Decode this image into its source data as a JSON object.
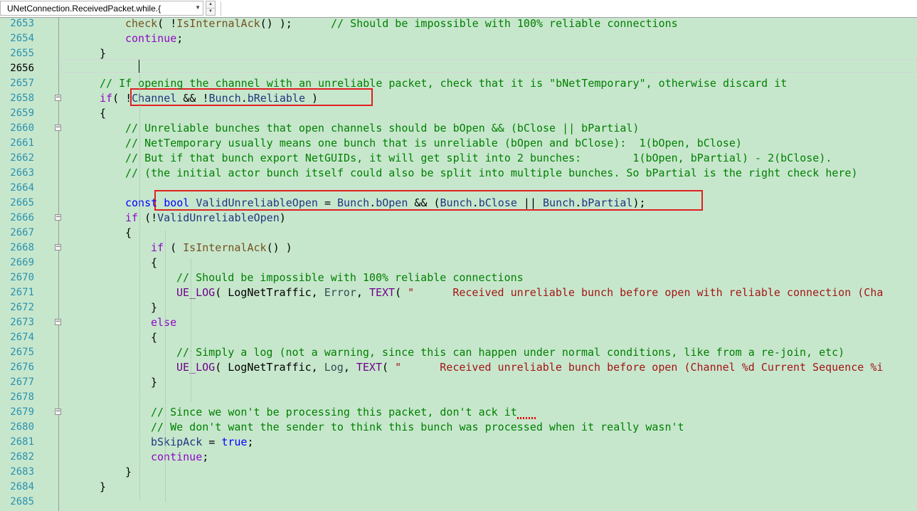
{
  "navigation": {
    "scope": "UNetConnection.ReceivedPacket.while.{"
  },
  "editor": {
    "current_line": 2656,
    "lines": [
      {
        "num": "2653",
        "indent": 4,
        "fold": false,
        "tokens": [
          [
            "fn",
            "check"
          ],
          [
            "pl",
            "( !"
          ],
          [
            "fn",
            "IsInternalAck"
          ],
          [
            "pl",
            "() );      "
          ],
          [
            "cm",
            "// Should be impossible with 100% reliable connections"
          ]
        ]
      },
      {
        "num": "2654",
        "indent": 4,
        "fold": false,
        "tokens": [
          [
            "ctl",
            "continue"
          ],
          [
            "pl",
            ";"
          ]
        ]
      },
      {
        "num": "2655",
        "indent": 3,
        "fold": false,
        "tokens": [
          [
            "pl",
            "}"
          ]
        ]
      },
      {
        "num": "2656",
        "indent": 3,
        "fold": false,
        "tokens": []
      },
      {
        "num": "2657",
        "indent": 3,
        "fold": false,
        "tokens": [
          [
            "cm",
            "// If opening the channel with an unreliable packet, check that it is \"bNetTemporary\", otherwise discard it"
          ]
        ]
      },
      {
        "num": "2658",
        "indent": 3,
        "fold": true,
        "tokens": [
          [
            "ctl",
            "if"
          ],
          [
            "pl",
            "( !"
          ],
          [
            "var",
            "Channel"
          ],
          [
            "pl",
            " && !"
          ],
          [
            "var",
            "Bunch"
          ],
          [
            "pl",
            "."
          ],
          [
            "var",
            "bReliable"
          ],
          [
            "pl",
            " )"
          ]
        ]
      },
      {
        "num": "2659",
        "indent": 3,
        "fold": false,
        "tokens": [
          [
            "pl",
            "{"
          ]
        ]
      },
      {
        "num": "2660",
        "indent": 4,
        "fold": true,
        "tokens": [
          [
            "cm",
            "// Unreliable bunches that open channels should be bOpen && (bClose || bPartial)"
          ]
        ]
      },
      {
        "num": "2661",
        "indent": 4,
        "fold": false,
        "tokens": [
          [
            "cm",
            "// NetTemporary usually means one bunch that is unreliable (bOpen and bClose):  1(bOpen, bClose)"
          ]
        ]
      },
      {
        "num": "2662",
        "indent": 4,
        "fold": false,
        "tokens": [
          [
            "cm",
            "// But if that bunch export NetGUIDs, it will get split into 2 bunches:        1(bOpen, bPartial) - 2(bClose)."
          ]
        ]
      },
      {
        "num": "2663",
        "indent": 4,
        "fold": false,
        "tokens": [
          [
            "cm",
            "// (the initial actor bunch itself could also be split into multiple bunches. So bPartial is the right check here)"
          ]
        ]
      },
      {
        "num": "2664",
        "indent": 4,
        "fold": false,
        "tokens": []
      },
      {
        "num": "2665",
        "indent": 4,
        "fold": false,
        "tokens": [
          [
            "kw",
            "const"
          ],
          [
            "pl",
            " "
          ],
          [
            "kw",
            "bool"
          ],
          [
            "pl",
            " "
          ],
          [
            "var",
            "ValidUnreliableOpen"
          ],
          [
            "pl",
            " = "
          ],
          [
            "var",
            "Bunch"
          ],
          [
            "pl",
            "."
          ],
          [
            "var",
            "bOpen"
          ],
          [
            "pl",
            " && ("
          ],
          [
            "var",
            "Bunch"
          ],
          [
            "pl",
            "."
          ],
          [
            "var",
            "bClose"
          ],
          [
            "pl",
            " || "
          ],
          [
            "var",
            "Bunch"
          ],
          [
            "pl",
            "."
          ],
          [
            "var",
            "bPartial"
          ],
          [
            "pl",
            ");"
          ]
        ]
      },
      {
        "num": "2666",
        "indent": 4,
        "fold": true,
        "tokens": [
          [
            "ctl",
            "if"
          ],
          [
            "pl",
            " (!"
          ],
          [
            "var",
            "ValidUnreliableOpen"
          ],
          [
            "pl",
            ")"
          ]
        ]
      },
      {
        "num": "2667",
        "indent": 4,
        "fold": false,
        "tokens": [
          [
            "pl",
            "{"
          ]
        ]
      },
      {
        "num": "2668",
        "indent": 5,
        "fold": true,
        "tokens": [
          [
            "ctl",
            "if"
          ],
          [
            "pl",
            " ( "
          ],
          [
            "fn",
            "IsInternalAck"
          ],
          [
            "pl",
            "() )"
          ]
        ]
      },
      {
        "num": "2669",
        "indent": 5,
        "fold": false,
        "tokens": [
          [
            "pl",
            "{"
          ]
        ]
      },
      {
        "num": "2670",
        "indent": 6,
        "fold": false,
        "tokens": [
          [
            "cm",
            "// Should be impossible with 100% reliable connections"
          ]
        ]
      },
      {
        "num": "2671",
        "indent": 6,
        "fold": false,
        "tokens": [
          [
            "mac",
            "UE_LOG"
          ],
          [
            "pl",
            "( "
          ],
          [
            "pl",
            "LogNetTraffic"
          ],
          [
            "pl",
            ", "
          ],
          [
            "enum",
            "Error"
          ],
          [
            "pl",
            ", "
          ],
          [
            "mac",
            "TEXT"
          ],
          [
            "pl",
            "( "
          ],
          [
            "str",
            "\"      Received unreliable bunch before open with reliable connection (Cha"
          ]
        ]
      },
      {
        "num": "2672",
        "indent": 5,
        "fold": false,
        "tokens": [
          [
            "pl",
            "}"
          ]
        ]
      },
      {
        "num": "2673",
        "indent": 5,
        "fold": true,
        "tokens": [
          [
            "ctl",
            "else"
          ]
        ]
      },
      {
        "num": "2674",
        "indent": 5,
        "fold": false,
        "tokens": [
          [
            "pl",
            "{"
          ]
        ]
      },
      {
        "num": "2675",
        "indent": 6,
        "fold": false,
        "tokens": [
          [
            "cm",
            "// Simply a log (not a warning, since this can happen under normal conditions, like from a re-join, etc)"
          ]
        ]
      },
      {
        "num": "2676",
        "indent": 6,
        "fold": false,
        "tokens": [
          [
            "mac",
            "UE_LOG"
          ],
          [
            "pl",
            "( "
          ],
          [
            "pl",
            "LogNetTraffic"
          ],
          [
            "pl",
            ", "
          ],
          [
            "enum",
            "Log"
          ],
          [
            "pl",
            ", "
          ],
          [
            "mac",
            "TEXT"
          ],
          [
            "pl",
            "( "
          ],
          [
            "str",
            "\"      Received unreliable bunch before open (Channel %d Current Sequence %i"
          ]
        ]
      },
      {
        "num": "2677",
        "indent": 5,
        "fold": false,
        "tokens": [
          [
            "pl",
            "}"
          ]
        ]
      },
      {
        "num": "2678",
        "indent": 5,
        "fold": false,
        "tokens": []
      },
      {
        "num": "2679",
        "indent": 5,
        "fold": true,
        "tokens": [
          [
            "cm",
            "// Since we won't be processing this packet, don't ack it"
          ]
        ]
      },
      {
        "num": "2680",
        "indent": 5,
        "fold": false,
        "tokens": [
          [
            "cm",
            "// We don't want the sender to think this bunch was processed when it really wasn't"
          ]
        ]
      },
      {
        "num": "2681",
        "indent": 5,
        "fold": false,
        "tokens": [
          [
            "var",
            "bSkipAck"
          ],
          [
            "pl",
            " = "
          ],
          [
            "kw",
            "true"
          ],
          [
            "pl",
            ";"
          ]
        ]
      },
      {
        "num": "2682",
        "indent": 5,
        "fold": false,
        "tokens": [
          [
            "ctl",
            "continue"
          ],
          [
            "pl",
            ";"
          ]
        ]
      },
      {
        "num": "2683",
        "indent": 4,
        "fold": false,
        "tokens": [
          [
            "pl",
            "}"
          ]
        ]
      },
      {
        "num": "2684",
        "indent": 3,
        "fold": false,
        "tokens": [
          [
            "pl",
            "}"
          ]
        ]
      },
      {
        "num": "2685",
        "indent": 3,
        "fold": false,
        "tokens": []
      }
    ]
  },
  "colors": {
    "background": "#c7e7cd",
    "line_number": "#2b91af",
    "keyword": "#0000ff",
    "control": "#8f08c4",
    "comment": "#008000",
    "string": "#a31515",
    "function": "#74531f",
    "variable": "#1f377f",
    "macro": "#6f008a",
    "highlight_box": "#e02020"
  }
}
